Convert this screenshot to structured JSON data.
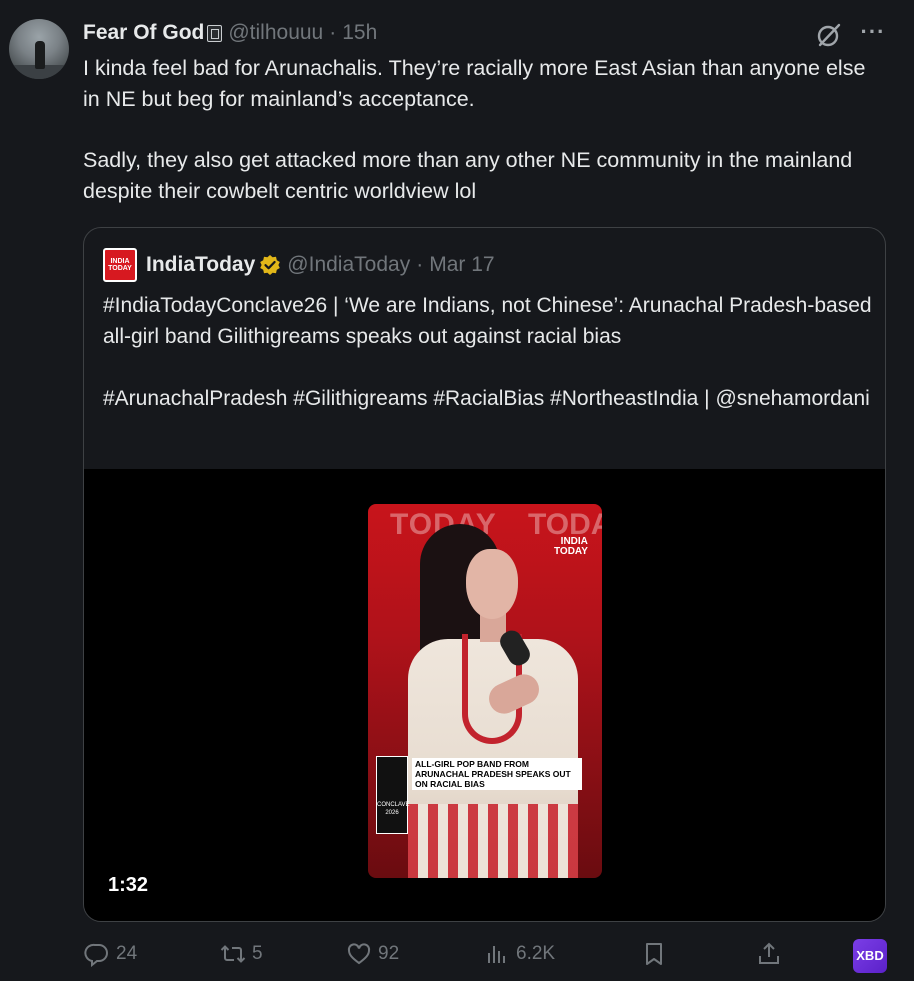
{
  "tweet": {
    "author_name": "Fear Of God",
    "handle": "@tilhouuu",
    "separator": "·",
    "time": "15h",
    "more_label": "···",
    "text_p1": "I kinda feel bad for Arunachalis. They’re racially more East Asian than anyone else in NE but beg for mainland’s acceptance.",
    "text_p2": "Sadly, they also get attacked more than any other NE community in the mainland despite their cowbelt centric worldview lol"
  },
  "quote": {
    "logo_line1": "INDIA",
    "logo_line2": "TODAY",
    "author_name": "IndiaToday",
    "handle": "@IndiaToday",
    "separator": "·",
    "time": "Mar 17",
    "text_p1": "#IndiaTodayConclave26 | ‘We are Indians, not Chinese’: Arunachal Pradesh-based all-girl band Gilithigreams speaks out against racial bias",
    "text_p2": "#ArunachalPradesh #Gilithigreams #RacialBias #NortheastIndia | @snehamordani",
    "video": {
      "duration": "1:32",
      "overlay_brand_left": "TODAY",
      "overlay_brand_right": "TODA",
      "corner_logo_line1": "INDIA",
      "corner_logo_line2": "TODAY",
      "caption": "ALL-GIRL POP BAND FROM ARUNACHAL PRADESH SPEAKS OUT ON RACIAL BIAS",
      "conclave_label": "CONCLAVE 2026"
    }
  },
  "actions": {
    "replies": "24",
    "reposts": "5",
    "likes": "92",
    "views": "6.2K",
    "extension_label": "XBD"
  },
  "colors": {
    "background": "#16181c",
    "text": "#e7e9ea",
    "muted": "#71767b",
    "verified_gold": "#e2b719",
    "brand_red": "#d71920"
  }
}
